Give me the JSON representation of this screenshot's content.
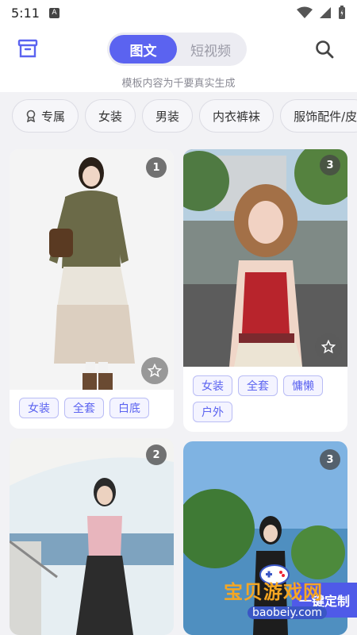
{
  "status": {
    "time": "5:11",
    "app_indicator": "A"
  },
  "header": {
    "tabs": [
      {
        "label": "图文",
        "active": true
      },
      {
        "label": "短视频",
        "active": false
      }
    ],
    "disclaimer": "模板内容为千要真实生成",
    "left_icon": "archive-icon",
    "right_icon": "search-icon"
  },
  "chips": [
    {
      "label": "专属",
      "icon": "badge-icon"
    },
    {
      "label": "女装"
    },
    {
      "label": "男装"
    },
    {
      "label": "内衣裤袜"
    },
    {
      "label": "服饰配件/皮"
    }
  ],
  "cards": [
    {
      "count": "1",
      "tags": [
        "女装",
        "全套",
        "白底"
      ],
      "starred": false
    },
    {
      "count": "3",
      "tags": [
        "女装",
        "全套",
        "慵懒",
        "户外"
      ],
      "starred": false
    },
    {
      "count": "2",
      "tags": []
    },
    {
      "count": "3",
      "tags": []
    }
  ],
  "watermark": {
    "text": "宝贝游戏网",
    "url": "baobeiy.com",
    "button": "一键定制"
  },
  "colors": {
    "accent": "#5b63f0",
    "background": "#f2f2f5"
  }
}
